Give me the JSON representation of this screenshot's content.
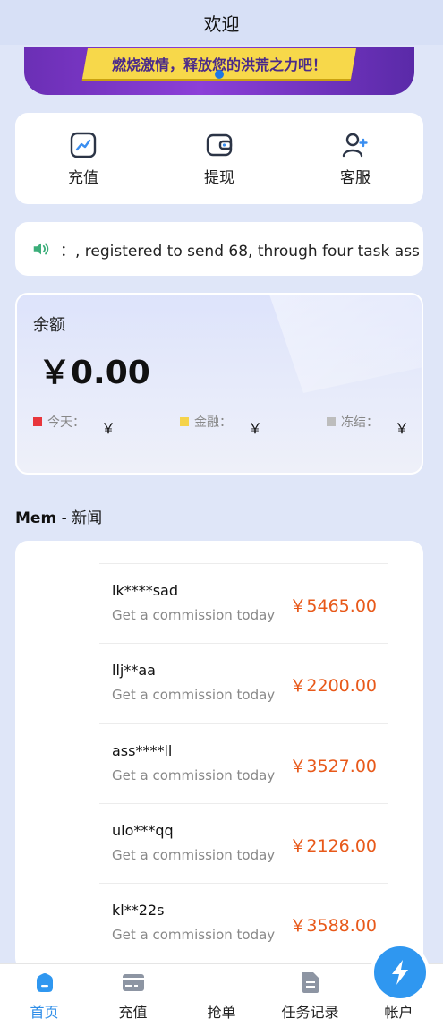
{
  "header": {
    "title": "欢迎"
  },
  "banner": {
    "text": "燃烧激情，释放您的洪荒之力吧！"
  },
  "quick_actions": [
    {
      "label": "充值",
      "icon": "chart-icon"
    },
    {
      "label": "提现",
      "icon": "wallet-icon"
    },
    {
      "label": "客服",
      "icon": "user-plus-icon"
    }
  ],
  "notice": {
    "icon": "speaker-icon",
    "text": "：, registered to send 68, through four task ass"
  },
  "balance": {
    "label": "余额",
    "amount": "￥0.00",
    "stats": [
      {
        "label": "今天：",
        "value": "￥",
        "color": "#e8363c"
      },
      {
        "label": "金融：",
        "value": "￥",
        "color": "#f5d34b"
      },
      {
        "label": "冻结：",
        "value": "￥",
        "color": "#bdbdbd"
      }
    ]
  },
  "news": {
    "title_bold": "Mem",
    "title_rest": " - 新闻",
    "items": [
      {
        "name": "lk****sad",
        "sub": "Get a commission today",
        "amount": "￥5465.00"
      },
      {
        "name": "llj**aa",
        "sub": "Get a commission today",
        "amount": "￥2200.00"
      },
      {
        "name": "ass****ll",
        "sub": "Get a commission today",
        "amount": "￥3527.00"
      },
      {
        "name": "ulo***qq",
        "sub": "Get a commission today",
        "amount": "￥2126.00"
      },
      {
        "name": "kl**22s",
        "sub": "Get a commission today",
        "amount": "￥3588.00"
      }
    ]
  },
  "tabbar": {
    "items": [
      {
        "label": "首页",
        "icon": "home-icon",
        "active": true
      },
      {
        "label": "充值",
        "icon": "card-icon",
        "active": false
      },
      {
        "label": "抢单",
        "icon": "lightning-icon",
        "active": false
      },
      {
        "label": "任务记录",
        "icon": "document-icon",
        "active": false
      },
      {
        "label": "帐户",
        "icon": "person-icon",
        "active": false
      }
    ],
    "accent": "#2f8ee8"
  }
}
